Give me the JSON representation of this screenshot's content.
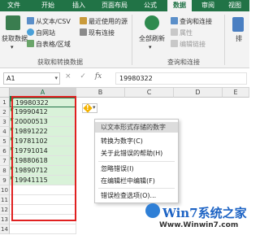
{
  "tabs": [
    "文件",
    "开始",
    "插入",
    "页面布局",
    "公式",
    "数据",
    "审阅",
    "视图"
  ],
  "active_tab": "数据",
  "ribbon": {
    "get_data": "获取数据",
    "from_csv": "从文本/CSV",
    "from_web": "自网站",
    "from_table": "自表格/区域",
    "recent_sources": "最近使用的源",
    "existing_conn": "现有连接",
    "group_get_transform": "获取和转换数据",
    "refresh_all": "全部刷新",
    "query_conn": "查询和连接",
    "properties": "属性",
    "edit_links": "编辑链接",
    "group_query": "查询和连接",
    "sort_partial": "排"
  },
  "formula_bar": {
    "name_box": "A1",
    "cancel": "×",
    "confirm": "✓",
    "fx": "fx",
    "value": "19980322"
  },
  "columns": [
    "A",
    "B",
    "C",
    "D",
    "E"
  ],
  "rows": [
    "1",
    "2",
    "3",
    "4",
    "5",
    "6",
    "7",
    "8",
    "9",
    "10",
    "11",
    "12",
    "13",
    "14"
  ],
  "cells": [
    "19980322",
    "19990412",
    "20000513",
    "19891222",
    "19781102",
    "19791014",
    "19880618",
    "19890712",
    "19941115"
  ],
  "context_menu": [
    "以文本形式存储的数字",
    "转换为数字(C)",
    "关于此错误的帮助(H)",
    "忽略错误(I)",
    "在编辑栏中编辑(F)",
    "错误检查选项(O)..."
  ],
  "watermark": {
    "brand": "Win7系统之家",
    "url": "Www.Winwin7.com"
  },
  "colors": {
    "excel_green": "#217346",
    "selection_fill": "#d9f2d9",
    "highlight_border": "#e02020",
    "warning": "#f3b200"
  }
}
